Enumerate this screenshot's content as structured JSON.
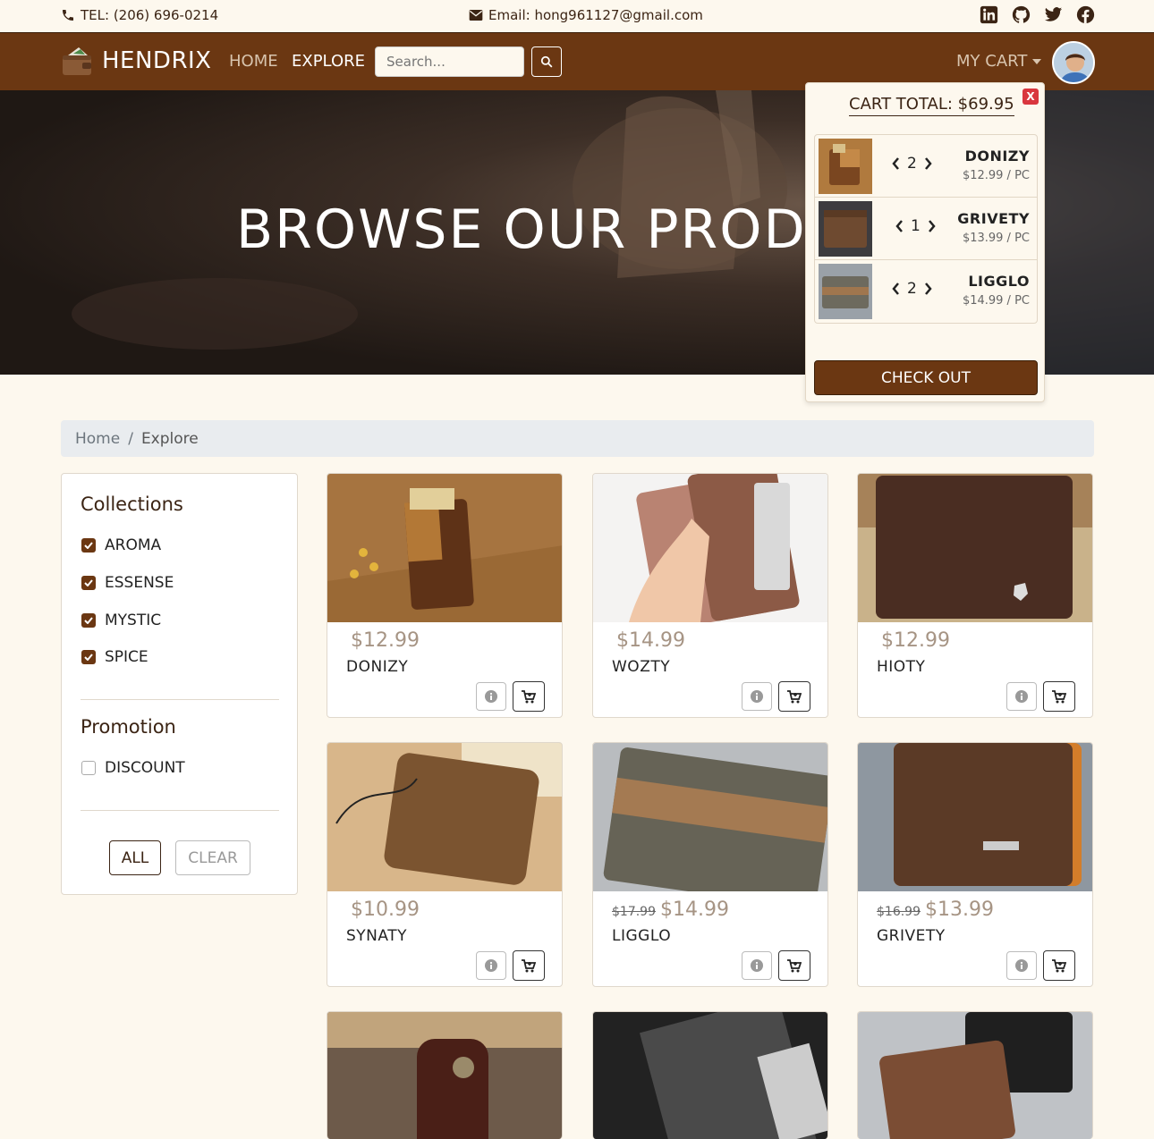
{
  "topbar": {
    "tel": "TEL: (206) 696-0214",
    "email": "Email: hong961127@gmail.com",
    "socials": [
      "linkedin-icon",
      "github-icon",
      "twitter-icon",
      "facebook-icon"
    ]
  },
  "navbar": {
    "brand": "HENDRIX",
    "links": [
      "HOME",
      "EXPLORE"
    ],
    "active_link": "EXPLORE",
    "search_placeholder": "Search...",
    "cart_label": "MY CART"
  },
  "hero": {
    "title": "BROWSE OUR PRODU"
  },
  "cart": {
    "close_label": "X",
    "total": "CART TOTAL: $69.95",
    "items": [
      {
        "name": "DONIZY",
        "qty": "2",
        "price": "$12.99 / PC"
      },
      {
        "name": "GRIVETY",
        "qty": "1",
        "price": "$13.99 / PC"
      },
      {
        "name": "LIGGLO",
        "qty": "2",
        "price": "$14.99 / PC"
      }
    ],
    "checkout_label": "CHECK OUT"
  },
  "breadcrumb": {
    "home": "Home",
    "separator": "/",
    "current": "Explore"
  },
  "sidebar": {
    "collections_title": "Collections",
    "collections": [
      {
        "label": "AROMA",
        "checked": true
      },
      {
        "label": "ESSENSE",
        "checked": true
      },
      {
        "label": "MYSTIC",
        "checked": true
      },
      {
        "label": "SPICE",
        "checked": true
      }
    ],
    "promotion_title": "Promotion",
    "promotions": [
      {
        "label": "DISCOUNT",
        "checked": false
      }
    ],
    "all_label": "ALL",
    "clear_label": "CLEAR"
  },
  "products": [
    {
      "name": "DONIZY",
      "price": "$12.99",
      "old_price": ""
    },
    {
      "name": "WOZTY",
      "price": "$14.99",
      "old_price": ""
    },
    {
      "name": "HIOTY",
      "price": "$12.99",
      "old_price": ""
    },
    {
      "name": "SYNATY",
      "price": "$10.99",
      "old_price": ""
    },
    {
      "name": "LIGGLO",
      "price": "$14.99",
      "old_price": "$17.99"
    },
    {
      "name": "GRIVETY",
      "price": "$13.99",
      "old_price": "$16.99"
    }
  ],
  "colors": {
    "brand": "#6b3712",
    "background": "#fdf8ee",
    "close": "#d9363e"
  }
}
